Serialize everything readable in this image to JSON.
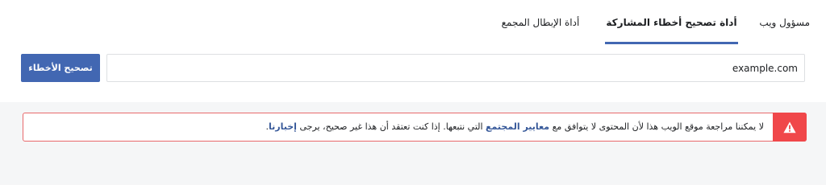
{
  "nav": {
    "tabs": [
      {
        "label": "مسؤول ويب",
        "active": false
      },
      {
        "label": "أداة تصحيح أخطاء المشاركة",
        "active": true
      },
      {
        "label": "أداة الإبطال المجمع",
        "active": false
      }
    ],
    "accent_color": "#4267b2"
  },
  "debugger": {
    "url_value": "example.com",
    "button_label": "تصحيح الأخطاء"
  },
  "alert": {
    "text_part1": "لا يمكننا مراجعة موقع الويب هذا لأن المحتوى لا يتوافق مع ",
    "link1": "معايير المجتمع",
    "text_part2": " التي نتبعها. إذا كنت تعتقد أن هذا غير صحيح، يرجى ",
    "link2": "إخبارنا",
    "text_part3": ".",
    "icon": "warning-icon",
    "icon_color": "#f0474a"
  }
}
